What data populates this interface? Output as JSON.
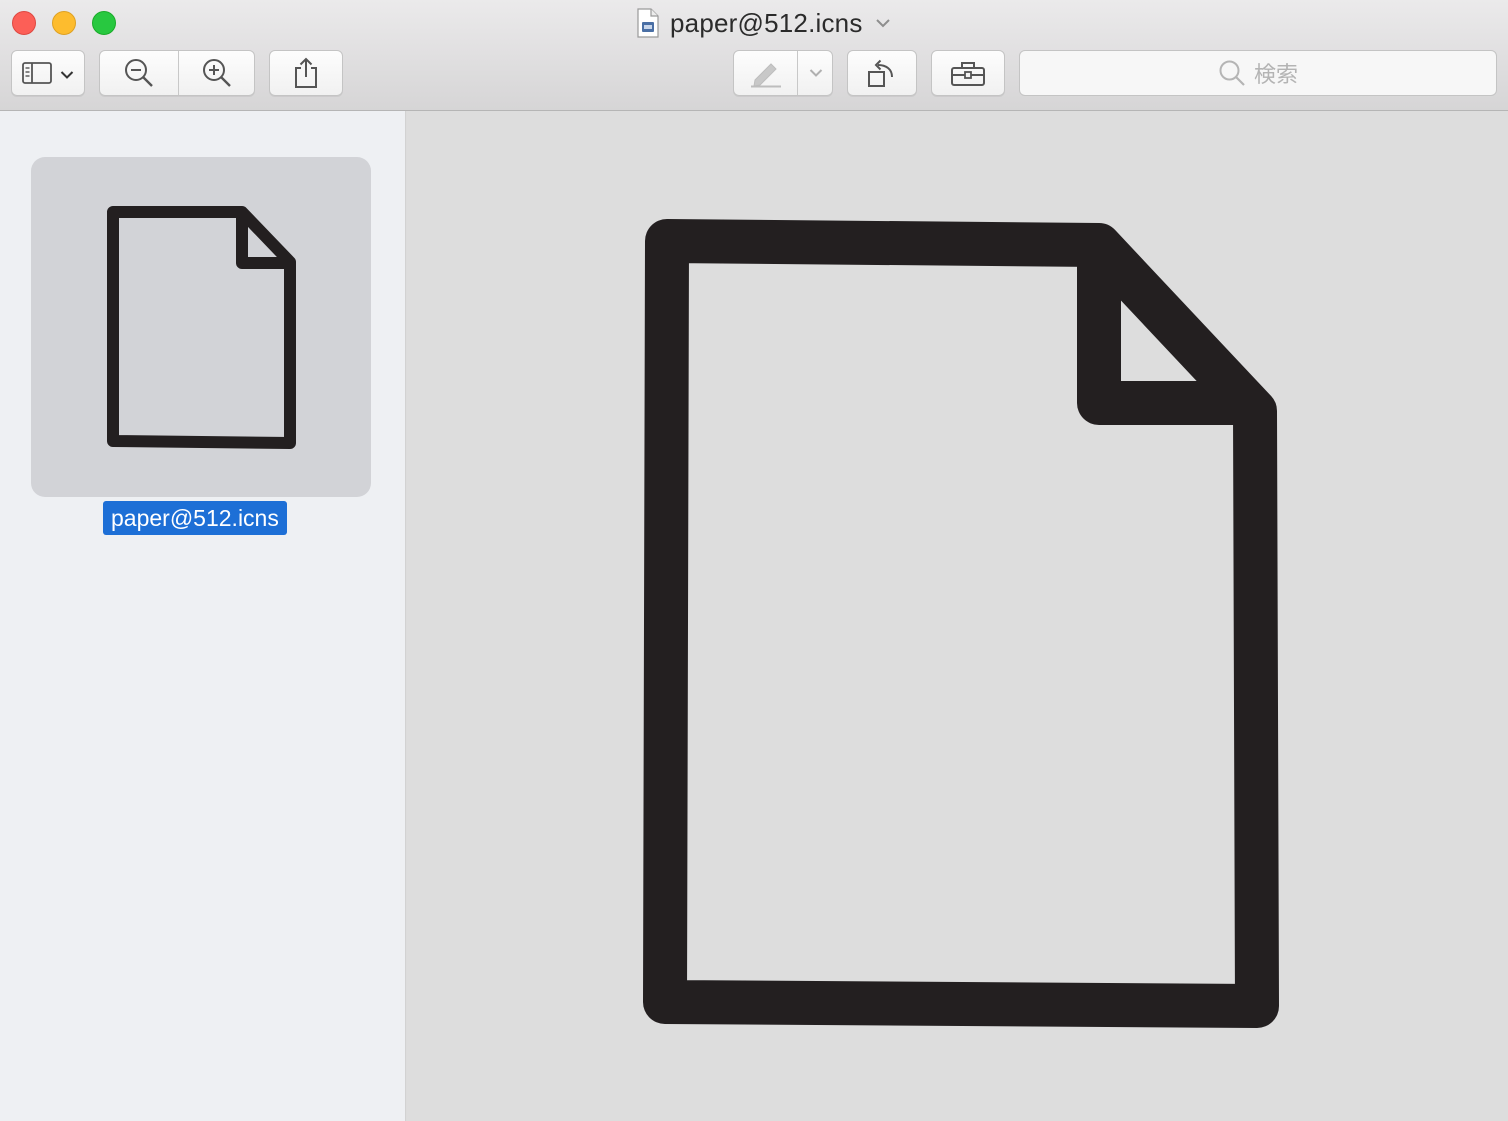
{
  "window": {
    "title": "paper@512.icns",
    "title_icon": "icns-document-icon",
    "title_menu_icon": "chevron-down-icon"
  },
  "traffic_lights": {
    "close_color": "#fc5f57",
    "minimize_color": "#fdbc2e",
    "zoom_color": "#28c840"
  },
  "toolbar": {
    "sidebar_toggle_icon": "sidebar-icon",
    "sidebar_menu_icon": "chevron-down-icon",
    "zoom_out_icon": "zoom-out-icon",
    "zoom_in_icon": "zoom-in-icon",
    "share_icon": "share-icon",
    "markup_icon": "markup-pen-icon",
    "markup_menu_icon": "chevron-down-icon",
    "rotate_icon": "rotate-left-icon",
    "toolbox_icon": "toolbox-icon"
  },
  "search": {
    "placeholder": "検索",
    "icon": "search-icon"
  },
  "sidebar": {
    "items": [
      {
        "label": "paper@512.icns",
        "selected": true,
        "icon": "paper-document-icon"
      }
    ],
    "selection_color": "#1d6fd6"
  },
  "preview": {
    "content_icon": "paper-document-icon",
    "background": "#dddddd",
    "stroke_color": "#231f20"
  }
}
